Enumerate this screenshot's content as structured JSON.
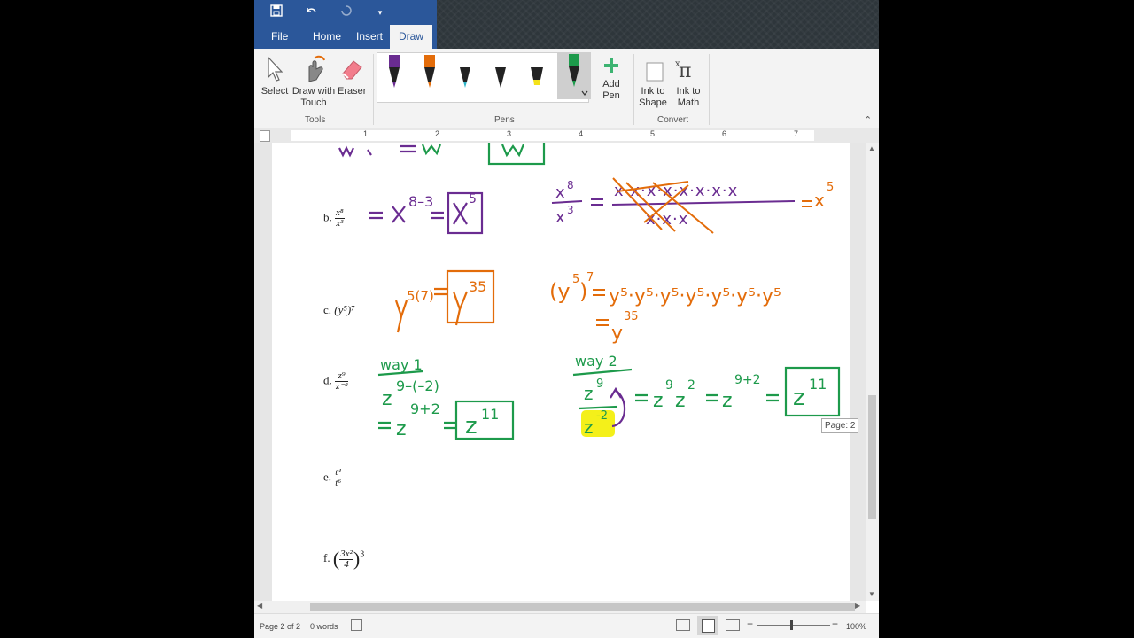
{
  "titlebar": {
    "save_icon": "save-icon",
    "undo_icon": "undo-icon",
    "redo_icon": "redo-icon",
    "customize_icon": "customize-qat-icon"
  },
  "tabs": [
    {
      "label": "File"
    },
    {
      "label": "Home"
    },
    {
      "label": "Insert"
    },
    {
      "label": "Draw",
      "active": true
    }
  ],
  "ribbon": {
    "tools": {
      "group_label": "Tools",
      "select": "Select",
      "draw_with_touch_line1": "Draw with",
      "draw_with_touch_line2": "Touch",
      "eraser": "Eraser"
    },
    "pens": {
      "group_label": "Pens",
      "colors": [
        "#6a2c91",
        "#e36c0a",
        "#2db4c8",
        "#222222",
        "#f4e21a",
        "#1d9a4b"
      ],
      "add_pen_line1": "Add",
      "add_pen_line2": "Pen"
    },
    "convert": {
      "group_label": "Convert",
      "ink_to_shape_line1": "Ink to",
      "ink_to_shape_line2": "Shape",
      "ink_to_math_line1": "Ink to",
      "ink_to_math_line2": "Math"
    }
  },
  "ruler": {
    "numbers": [
      "1",
      "2",
      "3",
      "4",
      "5",
      "6",
      "7"
    ]
  },
  "document": {
    "problems": [
      {
        "letter": "b.",
        "num": "x⁸",
        "den": "x³"
      },
      {
        "letter": "c.",
        "expr": "(y⁵)⁷"
      },
      {
        "letter": "d.",
        "num": "z⁹",
        "den": "z⁻²"
      },
      {
        "letter": "e.",
        "num": "t⁴",
        "den": "t⁶"
      },
      {
        "letter": "f.",
        "inner_num": "3x²",
        "inner_den": "4",
        "outer_exp": "3"
      }
    ],
    "ink_notes": {
      "way1": "way 1",
      "way2": "way 2"
    }
  },
  "page_tooltip": "Page: 2",
  "statusbar": {
    "page": "Page 2 of 2",
    "words": "0 words",
    "zoom": "100%"
  },
  "colors": {
    "accent": "#2b579a",
    "ink_purple": "#6a2c91",
    "ink_orange": "#e36c0a",
    "ink_green": "#1d9a4b",
    "highlight_yellow": "#f4f01a"
  }
}
